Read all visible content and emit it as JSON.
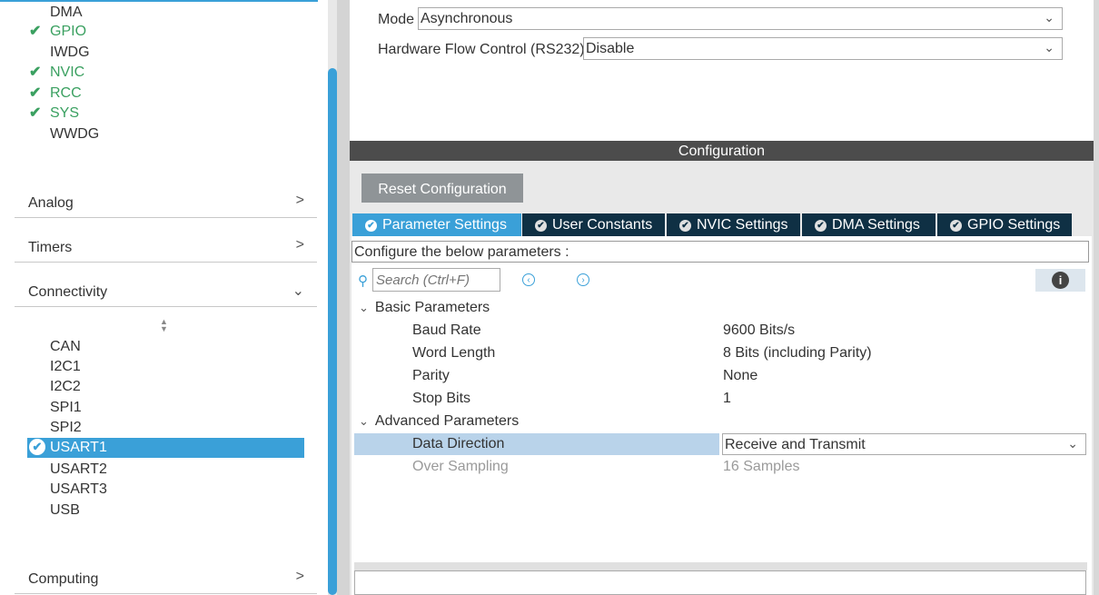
{
  "sidebar": {
    "system_core_items": [
      {
        "label": "DMA",
        "checked": false
      },
      {
        "label": "GPIO",
        "checked": true
      },
      {
        "label": "IWDG",
        "checked": false
      },
      {
        "label": "NVIC",
        "checked": true
      },
      {
        "label": "RCC",
        "checked": true
      },
      {
        "label": "SYS",
        "checked": true
      },
      {
        "label": "WWDG",
        "checked": false
      }
    ],
    "categories": {
      "analog": "Analog",
      "timers": "Timers",
      "connectivity": "Connectivity",
      "computing": "Computing"
    },
    "connectivity_items": [
      "CAN",
      "I2C1",
      "I2C2",
      "SPI1",
      "SPI2",
      "USART1",
      "USART2",
      "USART3",
      "USB"
    ],
    "selected": "USART1",
    "check_glyph": "✔",
    "accent": "#3aa0d8",
    "ok_color": "#3aa060"
  },
  "mode": {
    "mode_label": "Mode",
    "mode_value": "Asynchronous",
    "flow_label": "Hardware Flow Control (RS232)",
    "flow_value": "Disable"
  },
  "configuration": {
    "header": "Configuration",
    "reset_label": "Reset Configuration",
    "tabs": [
      "Parameter Settings",
      "User Constants",
      "NVIC Settings",
      "DMA Settings",
      "GPIO Settings"
    ],
    "active_tab": "Parameter Settings",
    "configure_text": "Configure the below parameters :",
    "search_placeholder": "Search (Ctrl+F)",
    "groups": {
      "basic": "Basic Parameters",
      "advanced": "Advanced Parameters"
    },
    "basic_params": [
      {
        "name": "Baud Rate",
        "value": "9600 Bits/s"
      },
      {
        "name": "Word Length",
        "value": "8 Bits (including Parity)"
      },
      {
        "name": "Parity",
        "value": "None"
      },
      {
        "name": "Stop Bits",
        "value": "1"
      }
    ],
    "advanced_params": [
      {
        "name": "Data Direction",
        "value": "Receive and Transmit"
      },
      {
        "name": "Over Sampling",
        "value": "16 Samples"
      }
    ]
  }
}
